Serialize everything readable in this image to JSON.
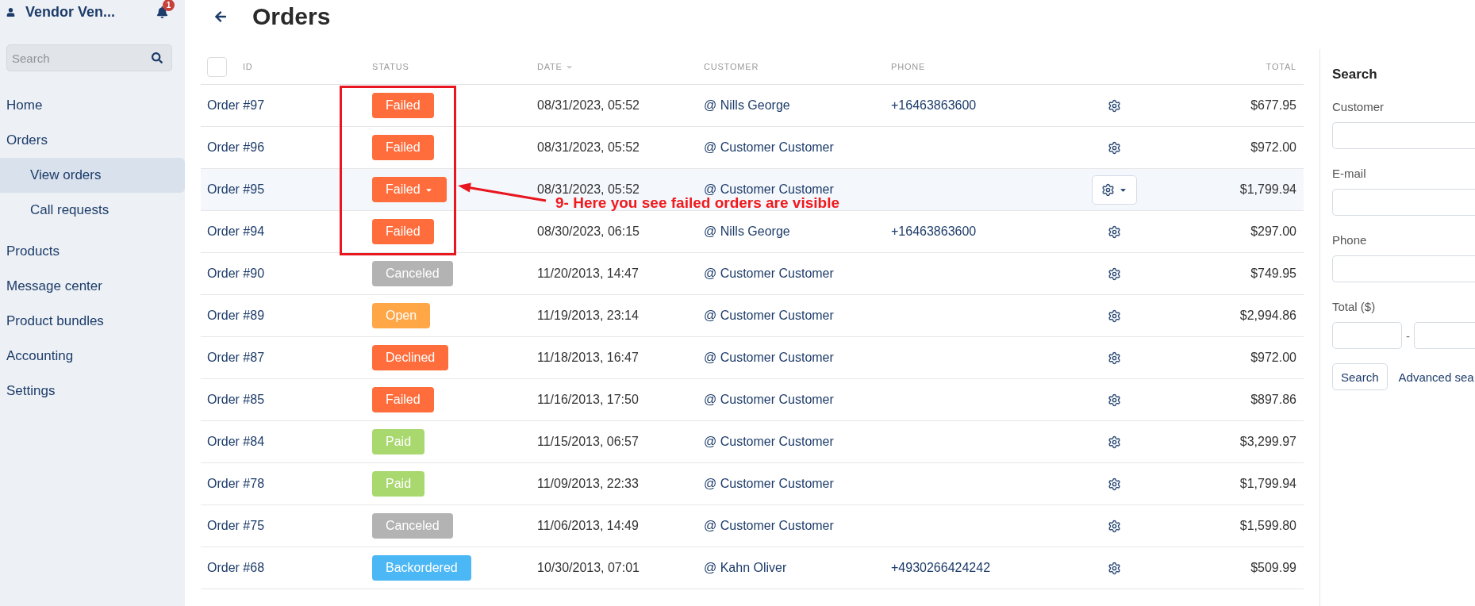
{
  "sidebar": {
    "account": {
      "name": "Vendor Ven...",
      "notifications": "1"
    },
    "search": {
      "placeholder": "Search"
    },
    "nav": [
      {
        "label": "Home",
        "selected": false
      },
      {
        "label": "Orders",
        "selected": false,
        "children": [
          {
            "label": "View orders",
            "selected": true
          },
          {
            "label": "Call requests",
            "selected": false
          }
        ]
      },
      {
        "label": "Products",
        "selected": false
      },
      {
        "label": "Message center",
        "selected": false
      },
      {
        "label": "Product bundles",
        "selected": false
      },
      {
        "label": "Accounting",
        "selected": false
      },
      {
        "label": "Settings",
        "selected": false
      }
    ]
  },
  "page": {
    "title": "Orders"
  },
  "table": {
    "select_all": {
      "checked": false
    },
    "columns": [
      {
        "label": "ID",
        "sorted": false
      },
      {
        "label": "STATUS",
        "sorted": false
      },
      {
        "label": "DATE",
        "sorted": true
      },
      {
        "label": "CUSTOMER",
        "sorted": false
      },
      {
        "label": "PHONE",
        "sorted": false
      },
      {
        "label": "TOTAL",
        "sorted": false
      }
    ],
    "rows": [
      {
        "id": "Order #97",
        "status": {
          "label": "Failed",
          "color": "#fe6d3b"
        },
        "date": "08/31/2023, 05:52",
        "customer": "@ Nills George",
        "phone": "+16463863600",
        "total": "$677.95",
        "hovered": false
      },
      {
        "id": "Order #96",
        "status": {
          "label": "Failed",
          "color": "#fe6d3b"
        },
        "date": "08/31/2023, 05:52",
        "customer": "@ Customer Customer",
        "total": "$972.00",
        "hovered": false
      },
      {
        "id": "Order #95",
        "status": {
          "label": "Failed",
          "color": "#fe6d3b"
        },
        "date": "08/31/2023, 05:52",
        "customer": "@ Customer Customer",
        "total": "$1,799.94",
        "hovered": true
      },
      {
        "id": "Order #94",
        "status": {
          "label": "Failed",
          "color": "#fe6d3b"
        },
        "date": "08/30/2023, 06:15",
        "customer": "@ Nills George",
        "phone": "+16463863600",
        "total": "$297.00",
        "hovered": false
      },
      {
        "id": "Order #90",
        "status": {
          "label": "Canceled",
          "color": "#b3b3b3"
        },
        "date": "11/20/2013, 14:47",
        "customer": "@ Customer Customer",
        "total": "$749.95",
        "hovered": false
      },
      {
        "id": "Order #89",
        "status": {
          "label": "Open",
          "color": "#ffa646"
        },
        "date": "11/19/2013, 23:14",
        "customer": "@ Customer Customer",
        "total": "$2,994.86",
        "hovered": false
      },
      {
        "id": "Order #87",
        "status": {
          "label": "Declined",
          "color": "#fe6d3b"
        },
        "date": "11/18/2013, 16:47",
        "customer": "@ Customer Customer",
        "total": "$972.00",
        "hovered": false
      },
      {
        "id": "Order #85",
        "status": {
          "label": "Failed",
          "color": "#fe6d3b"
        },
        "date": "11/16/2013, 17:50",
        "customer": "@ Customer Customer",
        "total": "$897.86",
        "hovered": false
      },
      {
        "id": "Order #84",
        "status": {
          "label": "Paid",
          "color": "#a8d86e"
        },
        "date": "11/15/2013, 06:57",
        "customer": "@ Customer Customer",
        "total": "$3,299.97",
        "hovered": false
      },
      {
        "id": "Order #78",
        "status": {
          "label": "Paid",
          "color": "#a8d86e"
        },
        "date": "11/09/2013, 22:33",
        "customer": "@ Customer Customer",
        "total": "$1,799.94",
        "hovered": false
      },
      {
        "id": "Order #75",
        "status": {
          "label": "Canceled",
          "color": "#b3b3b3"
        },
        "date": "11/06/2013, 14:49",
        "customer": "@ Customer Customer",
        "total": "$1,599.80",
        "hovered": false
      },
      {
        "id": "Order #68",
        "status": {
          "label": "Backordered",
          "color": "#4bb7f5"
        },
        "date": "10/30/2013, 07:01",
        "customer": "@ Kahn Oliver",
        "phone": "+4930266424242",
        "total": "$509.99",
        "hovered": false
      }
    ]
  },
  "search_panel": {
    "title": "Search",
    "fields": [
      {
        "label": "Customer"
      },
      {
        "label": "E-mail"
      },
      {
        "label": "Phone"
      }
    ],
    "total": {
      "label": "Total ($)",
      "separator": "-"
    },
    "button": "Search",
    "link": "Advanced sea"
  },
  "annotation": {
    "text": "9- Here you see failed orders are visible"
  }
}
